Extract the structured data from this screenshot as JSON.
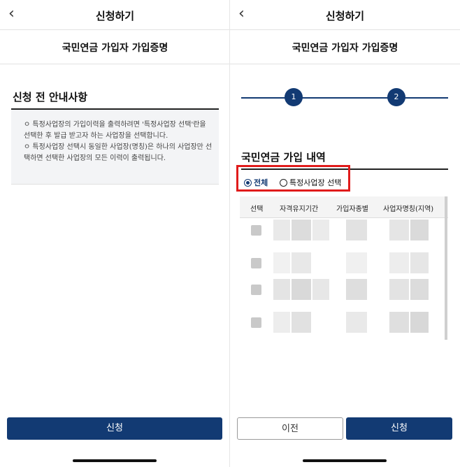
{
  "left": {
    "header": {
      "back_icon": "chevron-left-icon",
      "title": "신청하기"
    },
    "subtitle": "국민연금 가입자 가입증명",
    "notice": {
      "heading": "신청 전 안내사항",
      "bullets": [
        "ㅇ 특정사업장의 가입이력을 출력하려면 '특정사업장 선택'란을 선택한 후 발급 받고자 하는 사업장을 선택합니다.",
        "ㅇ 특정사업장 선택시 동일한 사업장(명칭)은 하나의 사업장만 선택하면 선택한 사업장의 모든 이력이 출력됩니다."
      ]
    },
    "apply_button": "신청"
  },
  "right": {
    "header": {
      "back_icon": "chevron-left-icon",
      "title": "신청하기"
    },
    "subtitle": "국민연금 가입자 가입증명",
    "steps": [
      "1",
      "2"
    ],
    "history_title": "국민연금 가입 내역",
    "radio": {
      "all": "전체",
      "specific": "특정사업장 선택",
      "selected": "all"
    },
    "table": {
      "headers": [
        "선택",
        "자격유지기간",
        "가입자종별",
        "사업자명칭(지역)"
      ],
      "row_count": 4
    },
    "prev_button": "이전",
    "apply_button": "신청"
  },
  "colors": {
    "primary": "#123a73",
    "highlight": "#e01b1b"
  }
}
